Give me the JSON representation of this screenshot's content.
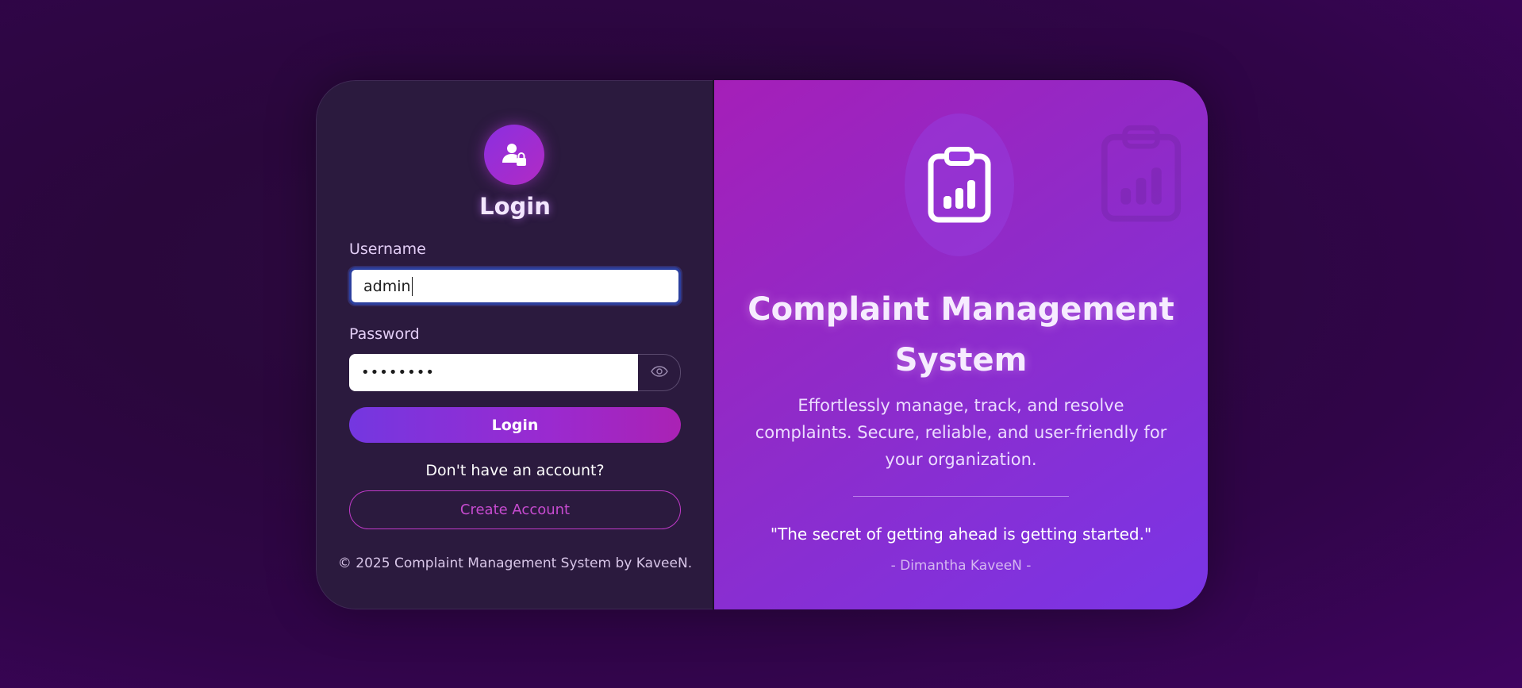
{
  "login": {
    "title": "Login",
    "username_label": "Username",
    "username_value": "admin",
    "password_label": "Password",
    "password_value": "••••••••",
    "login_button": "Login",
    "no_account_text": "Don't have an account?",
    "create_account_button": "Create Account",
    "copyright": "© 2025 Complaint Management System by KaveeN."
  },
  "hero": {
    "title_line1": "Complaint Management",
    "title_line2": "System",
    "subtitle": "Effortlessly manage, track, and resolve complaints. Secure, reliable, and user-friendly for your organization.",
    "quote": "\"The secret of getting ahead is getting started.\"",
    "author": "- Dimantha KaveeN -"
  },
  "icons": {
    "avatar": "user-lock-icon",
    "eye": "eye-icon",
    "hero": "clipboard-chart-icon"
  },
  "colors": {
    "background": "#2c0a40",
    "panel": "#2b1a3e",
    "accent_purple": "#7437e0",
    "accent_magenta": "#aa22b4",
    "hero_gradient_start": "#a51fb8",
    "hero_gradient_end": "#7a35e6"
  }
}
